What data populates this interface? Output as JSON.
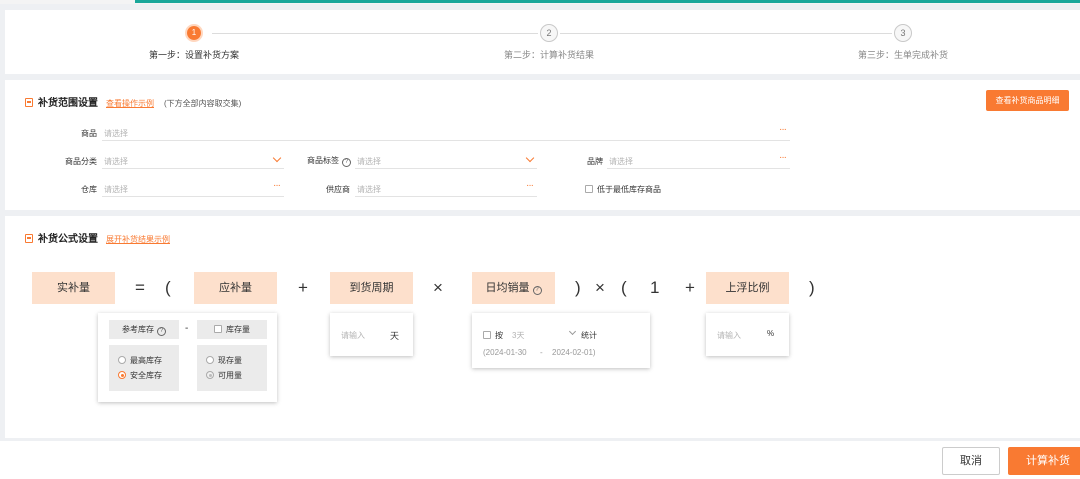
{
  "steps": [
    {
      "num": "1",
      "label": "第一步：设置补货方案"
    },
    {
      "num": "2",
      "label": "第二步：计算补货结果"
    },
    {
      "num": "3",
      "label": "第三步：生单完成补货"
    }
  ],
  "range": {
    "title": "补货范围设置",
    "link": "查看操作示例",
    "note": "(下方全部内容取交集)",
    "view_button": "查看补货商品明细",
    "placeholder": "请选择",
    "fields": {
      "product": "商品",
      "category": "商品分类",
      "tag": "商品标签",
      "brand": "品牌",
      "warehouse": "仓库",
      "supplier": "供应商"
    },
    "low_stock": "低于最低库存商品"
  },
  "formula": {
    "title": "补货公式设置",
    "link": "展开补货结果示例",
    "boxes": {
      "actual": "实补量",
      "should": "应补量",
      "cycle": "到货周期",
      "daily": "日均销量",
      "one": "1",
      "float": "上浮比例"
    },
    "ops": {
      "eq": "=",
      "lp": "(",
      "plus": "+",
      "times": "×",
      "rp": ")",
      "times2": "×",
      "lp2": "(",
      "plus2": "+",
      "rp2": ")"
    },
    "should_card": {
      "ref_stock": "参考库存",
      "minus": "-",
      "stock_qty": "库存量",
      "max_stock": "最高库存",
      "safe_stock": "安全库存",
      "current_stock": "现存量",
      "available": "可用量"
    },
    "cycle_card": {
      "placeholder": "请输入",
      "unit": "天"
    },
    "daily_card": {
      "by": "按",
      "days": "3天",
      "stat": "统计",
      "start": "(2024-01-30",
      "dash": "-",
      "end": "2024-02-01)"
    },
    "float_card": {
      "placeholder": "请输入",
      "unit": "%"
    }
  },
  "footer": {
    "cancel": "取消",
    "calculate": "计算补货"
  },
  "colors": {
    "accent": "#f97a32",
    "teal": "#1aa79a",
    "box_bg": "#fde0cc"
  }
}
